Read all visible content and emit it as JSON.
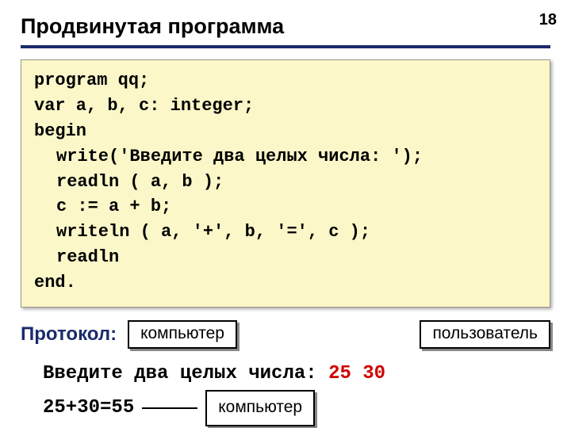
{
  "page_number": "18",
  "title": "Продвинутая программа",
  "code": {
    "l1": "program qq;",
    "l2": "var a, b, c: integer;",
    "l3": "begin",
    "l4": "write('Введите два целых числа: ');",
    "l5": "readln ( a, b );",
    "l6": "c := a + b;",
    "l7": "writeln ( a, '+', b, '=', c );",
    "l8": "readln",
    "l9": "end."
  },
  "protocol_label": "Протокол:",
  "labels": {
    "computer1": "компьютер",
    "user": "пользователь",
    "computer2": "компьютер"
  },
  "output": {
    "prompt": "Введите два целых числа:",
    "user_values": "25 30",
    "result": "25+30=55"
  }
}
